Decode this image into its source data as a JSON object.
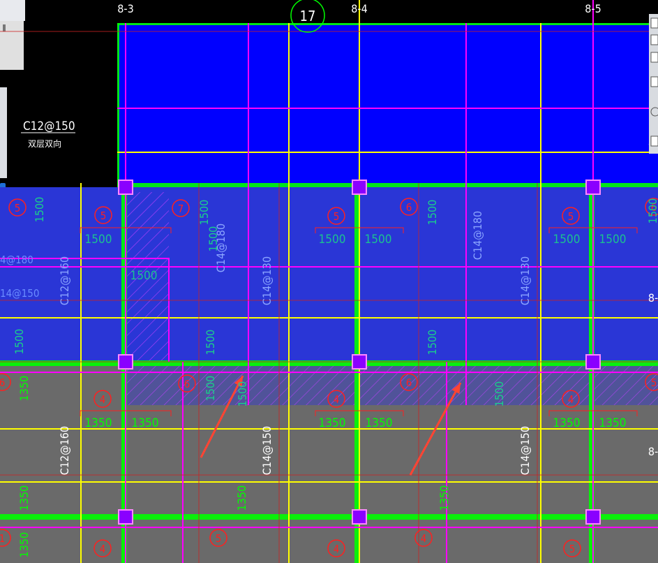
{
  "axes": {
    "top": [
      "8-3",
      "8-4",
      "8-5"
    ],
    "top_circle": "17",
    "right": [
      "8-",
      "8-",
      "8-"
    ]
  },
  "annotation": {
    "rebar": "C12@150",
    "note": "双层双向"
  },
  "left_cut_labels": [
    "4@180",
    "14@150"
  ],
  "rebar_labels": {
    "upper": [
      "C12@160",
      "C14@180",
      "C14@130",
      "C14@180",
      "C14@130"
    ],
    "lower": [
      "C12@160",
      "C14@150",
      "C14@150"
    ]
  },
  "slab_numbers": {
    "upper": [
      "5",
      "5",
      "7",
      "5",
      "6",
      "5",
      "6"
    ],
    "mid": [
      "6",
      "6",
      "4",
      "6",
      "4",
      "5"
    ],
    "lower": [
      "4",
      "4",
      "4",
      "5",
      "4",
      "5",
      "1"
    ]
  },
  "dims": {
    "upper_h": [
      "1500",
      "1500",
      "1500",
      "1500",
      "1500",
      "1500"
    ],
    "upper_v": [
      "1500",
      "1500",
      "1500",
      "1500",
      "1500",
      "1500"
    ],
    "mid_v": [
      "1500",
      "1500",
      "1500",
      "1500",
      "1500"
    ],
    "lower_h": [
      "1350",
      "1350",
      "1350",
      "1350",
      "1350",
      "1350"
    ],
    "lower_v": [
      "1350",
      "1350",
      "1350",
      "1350",
      "1350"
    ]
  },
  "colors": {
    "background": "#000000",
    "top_slab": "#0000ff",
    "mid_slab": "#2a36d6",
    "lower_slab": "#6a6a6a",
    "beam_green": "#00ff00",
    "axis_yellow": "#ffff00",
    "axis_magenta": "#ff00ff",
    "label_green": "#00ff00",
    "circle_red": "#ff2020",
    "arrow_red": "#ff4433"
  }
}
